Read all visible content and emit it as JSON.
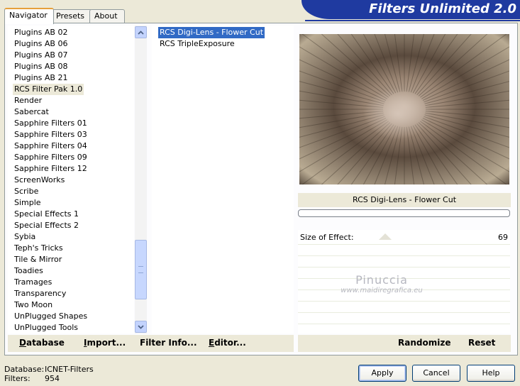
{
  "tabs": [
    {
      "label": "Navigator",
      "active": true
    },
    {
      "label": "Presets",
      "active": false
    },
    {
      "label": "About",
      "active": false
    }
  ],
  "banner_title": "Filters Unlimited 2.0",
  "categories": [
    "Plugins AB 02",
    "Plugins AB 06",
    "Plugins AB 07",
    "Plugins AB 08",
    "Plugins AB 21",
    "RCS Filter Pak 1.0",
    "Render",
    "Sabercat",
    "Sapphire Filters 01",
    "Sapphire Filters 03",
    "Sapphire Filters 04",
    "Sapphire Filters 09",
    "Sapphire Filters 12",
    "ScreenWorks",
    "Scribe",
    "Simple",
    "Special Effects 1",
    "Special Effects 2",
    "Sybia",
    "Teph's Tricks",
    "Tile & Mirror",
    "Toadies",
    "Tramages",
    "Transparency",
    "Two Moon",
    "UnPlugged Shapes",
    "UnPlugged Tools"
  ],
  "selected_category": "RCS Filter Pak 1.0",
  "scrollbar": {
    "up_icon": "chevron-up-icon",
    "down_icon": "chevron-down-icon",
    "position": 0.8
  },
  "filters": [
    "RCS Digi-Lens - Flower Cut",
    "RCS TripleExposure"
  ],
  "selected_filter": "RCS Digi-Lens - Flower Cut",
  "current_filter_name": "RCS Digi-Lens - Flower Cut",
  "progress": 0,
  "controls": [
    {
      "label": "Size of Effect:",
      "value": "69",
      "slider_fraction": 0.27
    }
  ],
  "watermark": {
    "line1": "Pinuccia",
    "line2": "www.maidiregrafica.eu"
  },
  "left_buttons": [
    {
      "label": "Database",
      "underline_char": "D",
      "rest": "atabase"
    },
    {
      "label": "Import...",
      "underline_char": "I",
      "rest": "mport..."
    },
    {
      "label": "Filter Info...",
      "underline_char": "",
      "rest": "Filter Info..."
    },
    {
      "label": "Editor...",
      "underline_char": "E",
      "rest": "ditor..."
    }
  ],
  "right_buttons": {
    "randomize": "Randomize",
    "reset": "Reset"
  },
  "status": {
    "database_label": "Database:",
    "database_value": "ICNET-Filters",
    "filters_label": "Filters:",
    "filters_value": "954"
  },
  "dialog_buttons": {
    "apply": "Apply",
    "cancel": "Cancel",
    "help": "Help"
  },
  "colors": {
    "banner": "#1f3aa0",
    "selection": "#316ac5",
    "panel_bg": "#ece9d8"
  }
}
